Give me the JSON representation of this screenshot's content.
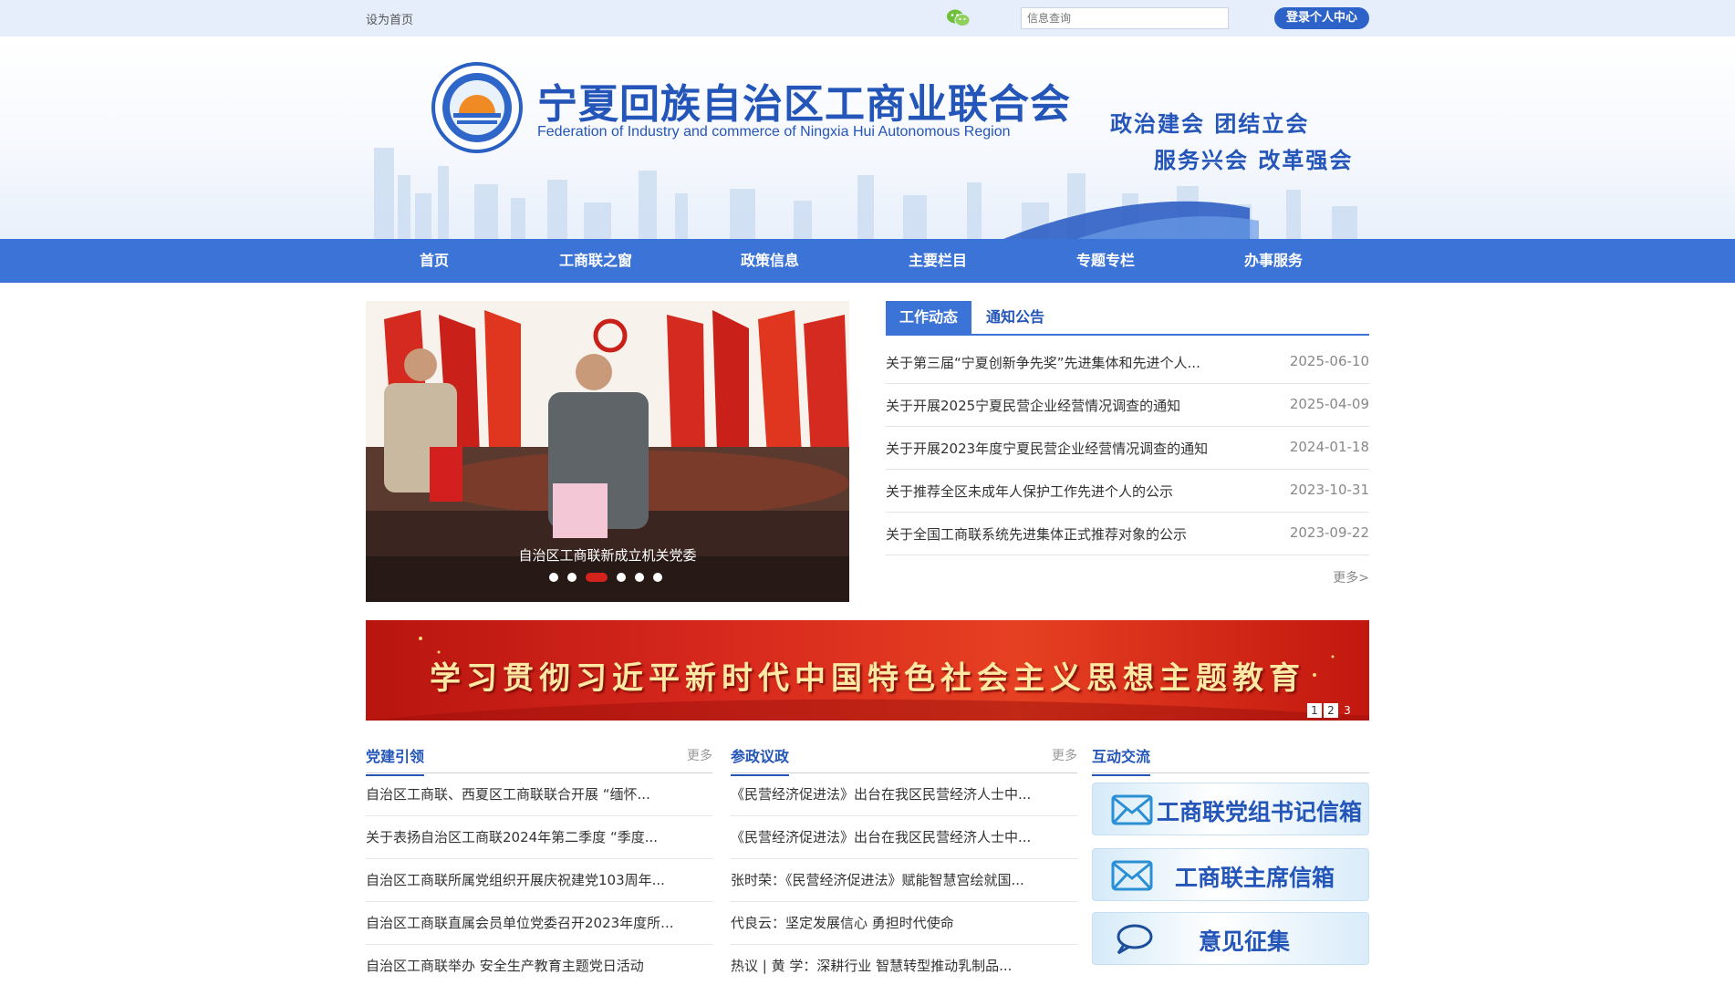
{
  "topbar": {
    "set_home": "设为首页",
    "search_placeholder": "信息查询",
    "login_label": "登录个人中心"
  },
  "header": {
    "title": "宁夏回族自治区工商业联合会",
    "subtitle": "Federation of Industry and commerce of  Ningxia Hui Autonomous Region",
    "slogan_line1": "政治建会  团结立会",
    "slogan_line2": "服务兴会  改革强会"
  },
  "nav": {
    "items": [
      {
        "label": "首页"
      },
      {
        "label": "工商联之窗"
      },
      {
        "label": "政策信息"
      },
      {
        "label": "主要栏目"
      },
      {
        "label": "专题专栏"
      },
      {
        "label": "办事服务"
      }
    ]
  },
  "slider": {
    "caption": "自治区工商联新成立机关党委",
    "active_dot_index": 2,
    "dot_count": 6
  },
  "news_tabs": {
    "active": "工作动态",
    "inactive": "通知公告"
  },
  "news": [
    {
      "title": "关于第三届“宁夏创新争先奖”先进集体和先进个人...",
      "date": "2025-06-10"
    },
    {
      "title": "关于开展2025宁夏民营企业经营情况调查的通知",
      "date": "2025-04-09"
    },
    {
      "title": "关于开展2023年度宁夏民营企业经营情况调查的通知",
      "date": "2024-01-18"
    },
    {
      "title": "关于推荐全区未成年人保护工作先进个人的公示",
      "date": "2023-10-31"
    },
    {
      "title": "关于全国工商联系统先进集体正式推荐对象的公示",
      "date": "2023-09-22"
    }
  ],
  "news_more": "更多>",
  "banner": {
    "text": "学习贯彻习近平新时代中国特色社会主义思想主题教育",
    "pages": [
      "1",
      "2",
      "3"
    ],
    "current_page": "3"
  },
  "columns": {
    "party": {
      "title": "党建引领",
      "more": "更多",
      "items": [
        "自治区工商联、西夏区工商联联合开展  “缅怀...",
        "关于表扬自治区工商联2024年第二季度  “季度...",
        "自治区工商联所属党组织开展庆祝建党103周年...",
        "自治区工商联直属会员单位党委召开2023年度所...",
        "自治区工商联举办 安全生产教育主题党日活动"
      ]
    },
    "politics": {
      "title": "参政议政",
      "more": "更多",
      "items": [
        "《民营经济促进法》出台在我区民营经济人士中...",
        "《民营经济促进法》出台在我区民营经济人士中...",
        "张时荣：《民营经济促进法》赋能智慧宫绘就国...",
        "代良云：坚定发展信心 勇担时代使命",
        "热议 | 黄 学：深耕行业 智慧转型推动乳制品..."
      ]
    },
    "interact": {
      "title": "互动交流",
      "boxes": [
        {
          "label": "工商联党组书记信箱"
        },
        {
          "label": "工商联主席信箱"
        },
        {
          "label": "意见征集"
        }
      ]
    }
  },
  "colors": {
    "brand_blue": "#2455b8",
    "nav_blue": "#3b73d6",
    "banner_red": "#d7281d",
    "accent_red": "#d3231c"
  }
}
